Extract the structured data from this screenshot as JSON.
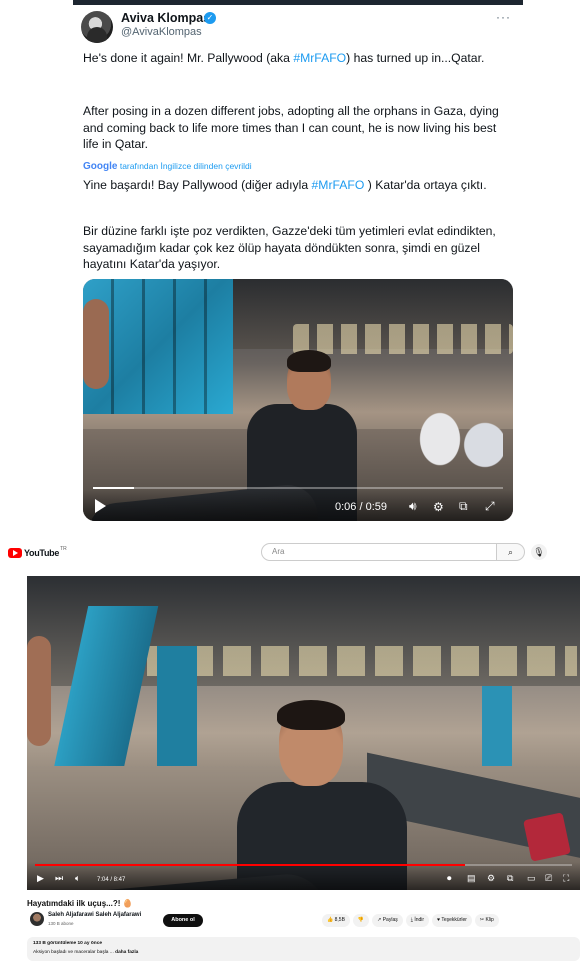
{
  "tweet": {
    "author_name": "Aviva Klompas",
    "author_handle": "@AvivaKlompas",
    "more": "···",
    "p1_before": "He's done it again! Mr. Pallywood (aka ",
    "p1_hashtag": "#MrFAFO",
    "p1_after": ") has turned up in...Qatar.",
    "p2": "After posing in a dozen different jobs, adopting all the orphans in Gaza, dying and coming back to life more times than I can count, he is now living his best life in Qatar.",
    "translation_brand": "Google",
    "translation_note": "tarafından İngilizce dilinden çevrildi",
    "tr_p1_before": "Yine başardı! Bay Pallywood (diğer adıyla ",
    "tr_p1_hashtag": "#MrFAFO",
    "tr_p1_after": " ) Katar'da ortaya çıktı.",
    "tr_p2": "Bir düzine farklı işte poz verdikten, Gazze'deki tüm yetimleri evlat edindikten, sayamadığım kadar çok kez ölüp hayata döndükten sonra, şimdi en güzel hayatını Katar'da yaşıyor.",
    "video": {
      "time": "0:06 / 0:59",
      "progress_fraction": 0.1,
      "icons": [
        "play-icon",
        "volume-icon",
        "settings-icon",
        "pip-icon",
        "fullscreen-icon"
      ]
    }
  },
  "youtube": {
    "logo_text": "YouTube",
    "logo_tm": "TR",
    "search_placeholder": "Ara",
    "video": {
      "time": "7:04 / 8:47",
      "progress_fraction": 0.8
    },
    "title": "Hayatımdaki ilk uçuş...?! 🥚",
    "channel_name": "Saleh Aljafarawi Saleh Aljafarawi",
    "subscribers": "130 B abone",
    "subscribe_label": "Abone ol",
    "actions": {
      "likes": "👍 8,5B",
      "dislike": "👎",
      "share": "↗ Paylaş",
      "download": "⤓ İndir",
      "thanks": "♥ Teşekkürler",
      "clip": "✂ Klip"
    },
    "description_meta": "133 B görüntüleme  10 ay önce",
    "description_text": "Aksiyon başladı ve maceralar başla ...",
    "description_more": "daha fazla"
  },
  "colors": {
    "twitter_blue": "#1d9bf0",
    "youtube_red": "#ff0000"
  }
}
